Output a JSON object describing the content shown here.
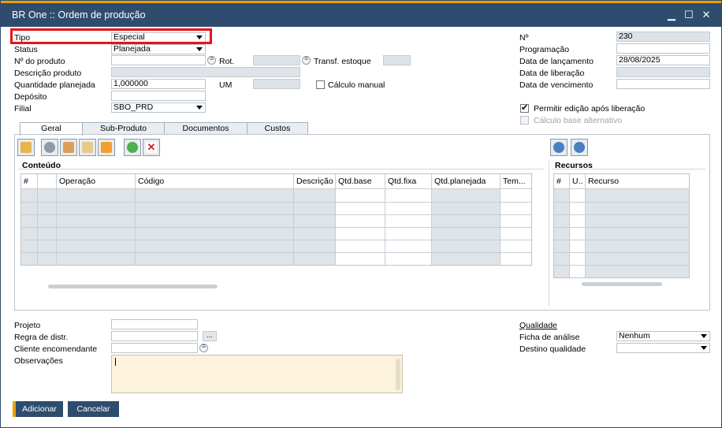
{
  "window": {
    "title": "BR One :: Ordem de produção",
    "minimize": "▁",
    "maximize": "☐",
    "close": "✕"
  },
  "header_left": {
    "tipo_label": "Tipo",
    "tipo_value": "Especial",
    "status_label": "Status",
    "status_value": "Planejada",
    "produto_label": "Nº do produto",
    "produto_value": "",
    "rot_label": "Rot.",
    "transf_label": "Transf. estoque",
    "descricao_label": "Descrição produto",
    "qtd_label": "Quantidade planejada",
    "qtd_value": "1,000000",
    "um_label": "UM",
    "calculo_label": "Cálculo manual",
    "deposito_label": "Depósito",
    "filial_label": "Filial",
    "filial_value": "SBO_PRD"
  },
  "header_right": {
    "numero_label": "Nº",
    "numero_value": "230",
    "programacao_label": "Programação",
    "lancamento_label": "Data de lançamento",
    "lancamento_value": "28/08/2025",
    "liberacao_label": "Data de liberação",
    "vencimento_label": "Data de vencimento",
    "permitir_label": "Permitir edição após liberação",
    "permitir_checked": true,
    "calculo_alt_label": "Cálculo base alternativo"
  },
  "tabs": [
    {
      "label": "Geral",
      "active": true
    },
    {
      "label": "Sub-Produto",
      "active": false
    },
    {
      "label": "Documentos",
      "active": false
    },
    {
      "label": "Custos",
      "active": false
    }
  ],
  "toolbar": {
    "icons": [
      "open-folder-icon",
      "settings-gear-icon",
      "users-icon",
      "tools-icon",
      "package-icon",
      "refresh-icon",
      "delete-icon"
    ],
    "resource_icons": [
      "add-resource-icon",
      "remove-resource-icon"
    ]
  },
  "conteudo": {
    "title": "Conteúdo",
    "columns": [
      "#",
      "",
      "Operação",
      "Código",
      "Descrição",
      "Qtd.base",
      "Qtd.fixa",
      "Qtd.planejada",
      "Tem..."
    ]
  },
  "recursos": {
    "title": "Recursos",
    "columns": [
      "#",
      "U..",
      "Recurso"
    ]
  },
  "footer": {
    "projeto_label": "Projeto",
    "regra_label": "Regra de distr.",
    "regra_btn": "...",
    "cliente_label": "Cliente encomendante",
    "observacoes_label": "Observações",
    "qualidade_label": "Qualidade",
    "ficha_label": "Ficha de análise",
    "ficha_value": "Nenhum",
    "destino_label": "Destino qualidade",
    "destino_value": ""
  },
  "buttons": {
    "add": "Adicionar",
    "cancel": "Cancelar"
  },
  "colors": {
    "titlebar": "#2e4c6e",
    "accent": "#e8a200",
    "highlight": "#e8141a"
  }
}
